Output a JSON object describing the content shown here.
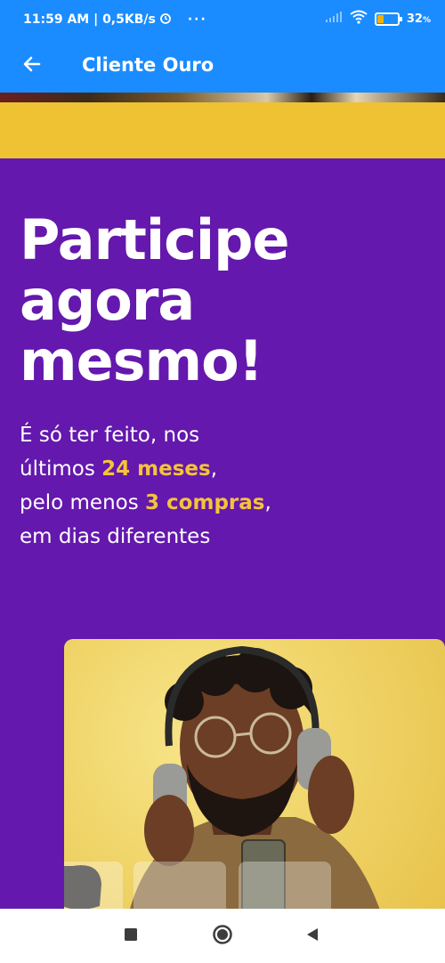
{
  "status_bar": {
    "time_speed": "11:59 AM | 0,5KB/s",
    "more": "···",
    "battery_percent": "32",
    "battery_unit": "%",
    "battery_level": 0.32,
    "icons": [
      "alarm-icon",
      "signal-icon",
      "wifi-icon",
      "battery-icon"
    ]
  },
  "toolbar": {
    "title": "Cliente Ouro",
    "back_icon": "arrow-left-icon"
  },
  "promo": {
    "headline": [
      "Participe",
      "agora",
      "mesmo!"
    ],
    "line1": "É só ter feito, nos",
    "line2_pre": "últimos ",
    "line2_hl": "24 meses",
    "line2_post": ",",
    "line3_pre": "pelo menos ",
    "line3_hl": "3 compras",
    "line3_post": ",",
    "line4": "em dias diferentes"
  },
  "colors": {
    "app_bar": "#1a8cff",
    "promo_background": "#6418ad",
    "accent_yellow": "#f4c33b",
    "band_yellow": "#eec232"
  },
  "nav": {
    "icons": [
      "square-recents-icon",
      "circle-home-icon",
      "triangle-back-icon"
    ]
  }
}
